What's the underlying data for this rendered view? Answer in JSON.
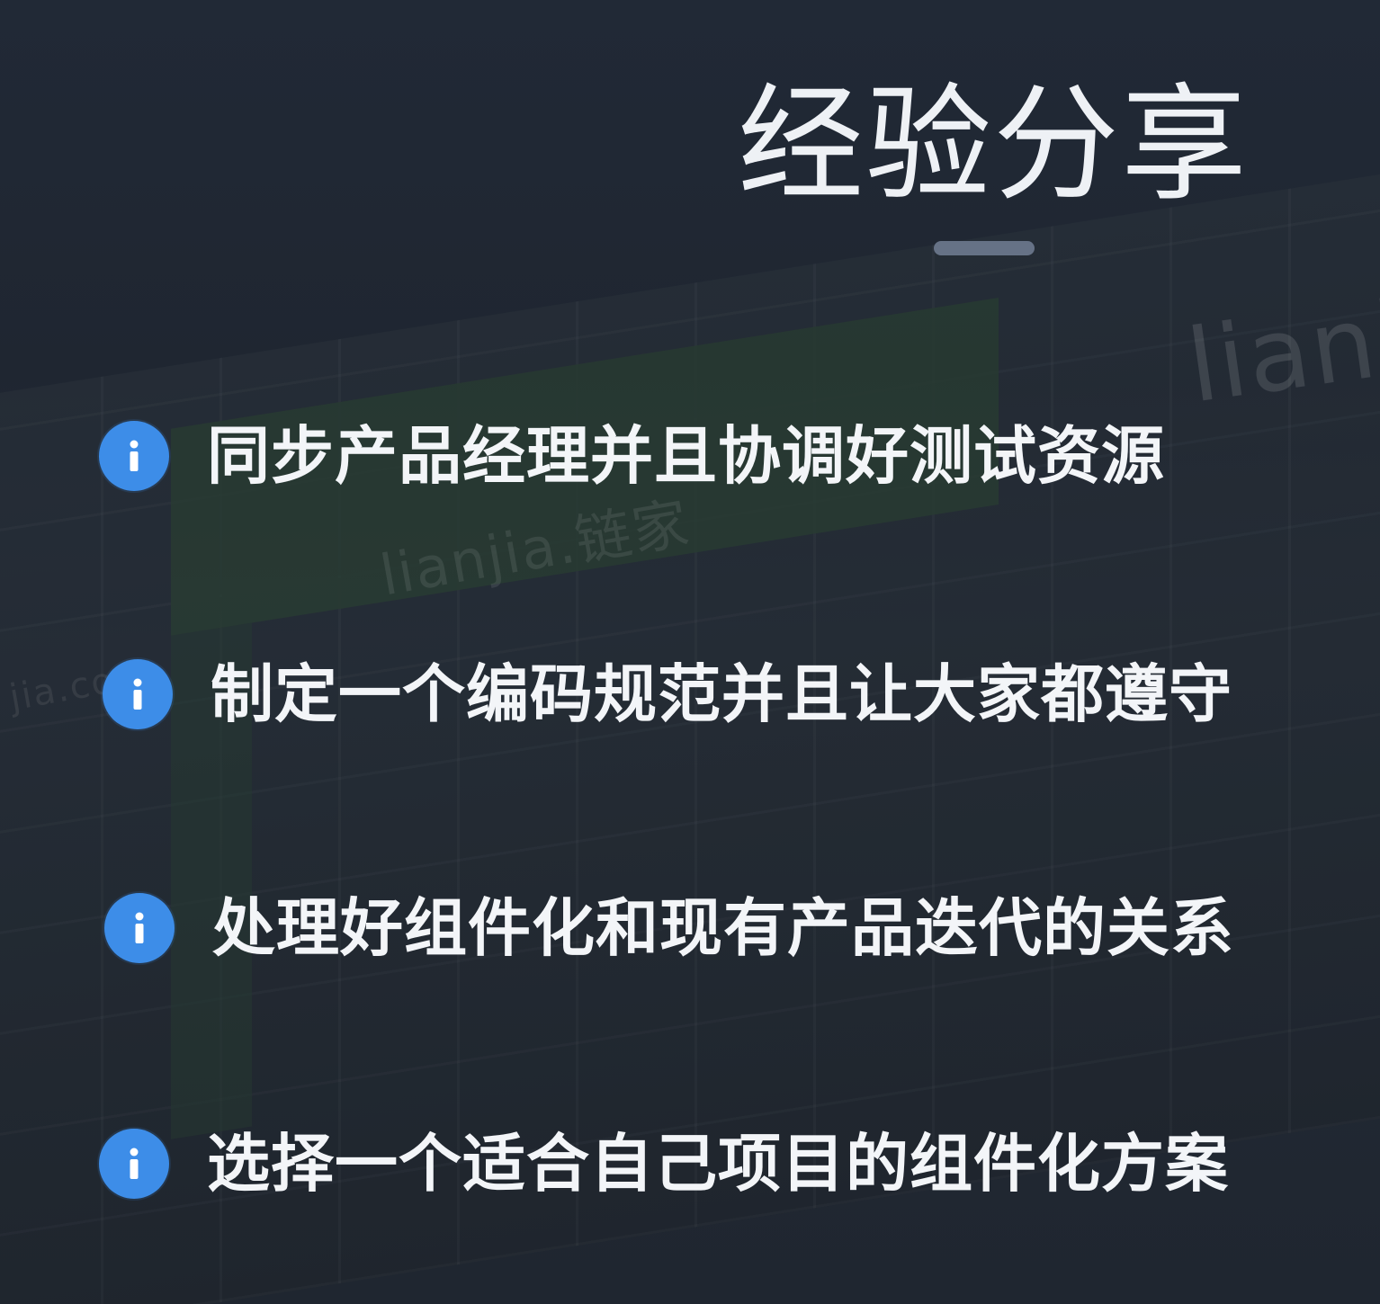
{
  "slide": {
    "title": "经验分享",
    "items": [
      {
        "icon": "info-icon",
        "text": "同步产品经理并且协调好测试资源"
      },
      {
        "icon": "info-icon",
        "text": "制定一个编码规范并且让大家都遵守"
      },
      {
        "icon": "info-icon",
        "text": "处理好组件化和现有产品迭代的关系"
      },
      {
        "icon": "info-icon",
        "text": "选择一个适合自己项目的组件化方案"
      }
    ]
  },
  "background": {
    "logo_text": "lianjia",
    "logo_text_small": "lianjia.链家",
    "logo_text_url": "jia.com"
  },
  "colors": {
    "background": "#1f2631",
    "accent": "#3d8de8",
    "underline": "#667286",
    "text": "#f3f5f8"
  }
}
